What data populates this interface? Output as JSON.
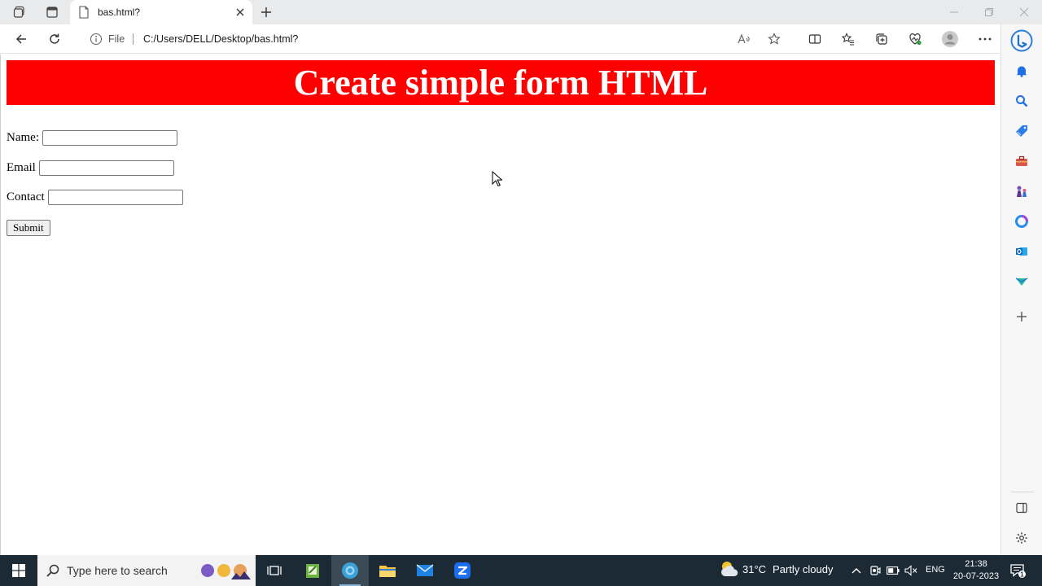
{
  "browser": {
    "tab_title": "bas.html?",
    "file_label": "File",
    "url": "C:/Users/DELL/Desktop/bas.html?"
  },
  "page": {
    "heading": "Create simple form HTML",
    "form": {
      "name_label": "Name:",
      "email_label": "Email",
      "contact_label": "Contact",
      "submit_label": "Submit"
    }
  },
  "taskbar": {
    "search_placeholder": "Type here to search",
    "weather_temp": "31°C",
    "weather_condition": "Partly cloudy",
    "language": "ENG",
    "time": "21:38",
    "date": "20-07-2023",
    "notification_count": "1"
  },
  "colors": {
    "banner_bg": "#ff0000",
    "banner_text": "#ffffff",
    "taskbar_bg": "#1b2a35"
  },
  "icons": {
    "sidebar": [
      "bing-icon",
      "bell-icon",
      "search-icon",
      "shopping-tag-icon",
      "toolbox-icon",
      "games-icon",
      "office-icon",
      "outlook-icon",
      "drop-icon",
      "add-icon",
      "split-pane-icon",
      "settings-icon"
    ]
  }
}
